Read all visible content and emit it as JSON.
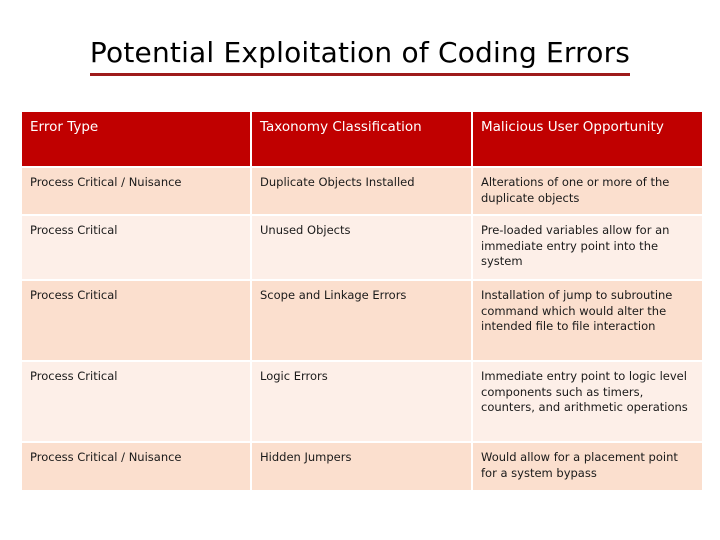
{
  "slide": {
    "title": "Potential Exploitation of Coding Errors",
    "title_underline_color": "#9E1B1B",
    "background_color": "#FFFFFF"
  },
  "table": {
    "header_background": "#C00000",
    "header_text_color": "#FFFFFF",
    "row_color_odd": "#FBDFCE",
    "row_color_even": "#FDEFE8",
    "columns": [
      "Error Type",
      "Taxonomy Classification",
      "Malicious User Opportunity"
    ],
    "rows": [
      {
        "error_type": "Process Critical / Nuisance",
        "taxonomy_classification": "Duplicate Objects Installed",
        "malicious_user_opportunity": "Alterations of one or more of the duplicate objects"
      },
      {
        "error_type": "Process Critical",
        "taxonomy_classification": "Unused Objects",
        "malicious_user_opportunity": "Pre-loaded variables allow for an immediate entry point into the system"
      },
      {
        "error_type": "Process Critical",
        "taxonomy_classification": "Scope and Linkage Errors",
        "malicious_user_opportunity": "Installation of jump to subroutine command which would alter the intended file to file interaction"
      },
      {
        "error_type": "Process Critical",
        "taxonomy_classification": "Logic Errors",
        "malicious_user_opportunity": "Immediate entry point to logic level components such as timers, counters, and arithmetic operations"
      },
      {
        "error_type": "Process Critical / Nuisance",
        "taxonomy_classification": "Hidden Jumpers",
        "malicious_user_opportunity": "Would allow for a placement point for a system bypass"
      }
    ]
  }
}
